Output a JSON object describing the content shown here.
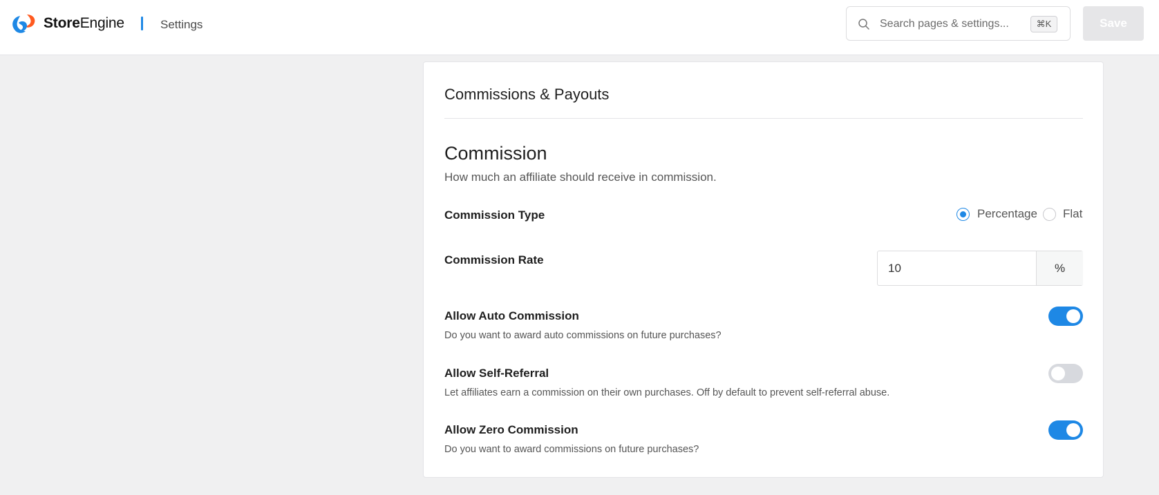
{
  "header": {
    "brand_bold": "Store",
    "brand_light": "Engine",
    "title": "Settings",
    "search_placeholder": "Search pages & settings...",
    "search_shortcut": "⌘K",
    "save_label": "Save",
    "accent_color": "#1e88e5"
  },
  "card": {
    "title": "Commissions & Payouts",
    "section_heading": "Commission",
    "section_description": "How much an affiliate should receive in commission.",
    "commission_type": {
      "label": "Commission Type",
      "options": [
        "Percentage",
        "Flat"
      ],
      "selected": "Percentage"
    },
    "commission_rate": {
      "label": "Commission Rate",
      "value": "10",
      "unit": "%"
    },
    "settings": [
      {
        "label": "Allow Auto Commission",
        "help": "Do you want to award auto commissions on future purchases?",
        "enabled": true
      },
      {
        "label": "Allow Self-Referral",
        "help": "Let affiliates earn a commission on their own purchases. Off by default to prevent self-referral abuse.",
        "enabled": false
      },
      {
        "label": "Allow Zero Commission",
        "help": "Do you want to award commissions on future purchases?",
        "enabled": true
      }
    ]
  }
}
